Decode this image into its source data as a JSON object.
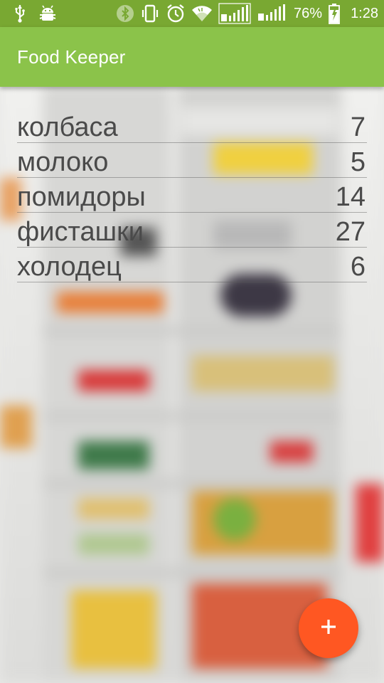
{
  "status_bar": {
    "battery_percent": "76%",
    "time": "1:28",
    "icons": [
      "usb-icon",
      "android-debug-icon",
      "bluetooth-icon",
      "vibrate-icon",
      "alarm-icon",
      "wifi-icon",
      "signal-sim1-icon",
      "signal-sim2-icon",
      "battery-charging-icon"
    ]
  },
  "app_bar": {
    "title": "Food Keeper",
    "color": "#8bc34a",
    "status_color": "#79a832"
  },
  "food_items": [
    {
      "name": "колбаса",
      "count": "7"
    },
    {
      "name": "молоко",
      "count": "5"
    },
    {
      "name": "помидоры",
      "count": "14"
    },
    {
      "name": "фисташки",
      "count": "27"
    },
    {
      "name": "холодец",
      "count": "6"
    }
  ],
  "fab": {
    "icon": "plus-icon",
    "color": "#ff5722"
  }
}
